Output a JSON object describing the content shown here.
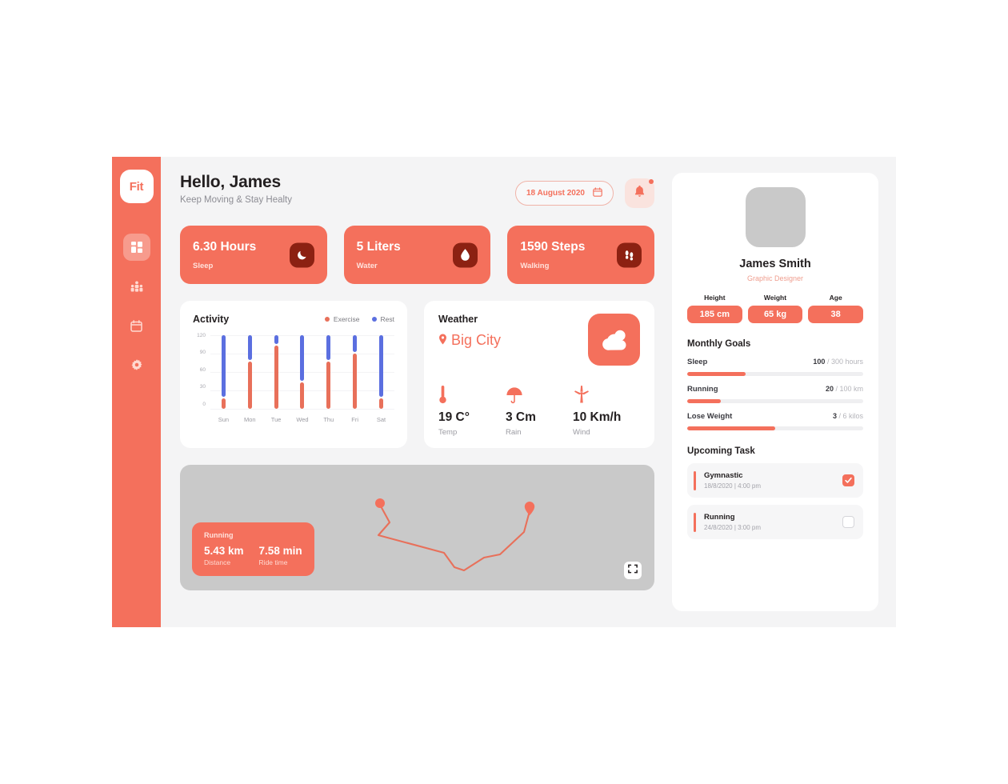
{
  "brand": {
    "logo_text": "Fit",
    "accent": "#F4705C",
    "accent_dark": "#8C2112",
    "rest_color": "#5B6FE0",
    "exercise_color": "#E8705A"
  },
  "sidebar": {
    "items": [
      {
        "name": "dashboard",
        "icon": "grid-icon",
        "active": true
      },
      {
        "name": "community",
        "icon": "people-icon",
        "active": false
      },
      {
        "name": "calendar",
        "icon": "calendar-icon",
        "active": false
      },
      {
        "name": "settings",
        "icon": "gear-icon",
        "active": false
      }
    ]
  },
  "header": {
    "title": "Hello, James",
    "subtitle": "Keep Moving & Stay Healty",
    "date_value": "18 August 2020",
    "date_icon": "calendar-icon",
    "bell_icon": "bell-icon"
  },
  "stats": [
    {
      "value": "6.30 Hours",
      "label": "Sleep",
      "icon": "moon-icon"
    },
    {
      "value": "5 Liters",
      "label": "Water",
      "icon": "water-drop-icon"
    },
    {
      "value": "1590 Steps",
      "label": "Walking",
      "icon": "footsteps-icon"
    }
  ],
  "chart_data": {
    "type": "bar",
    "title": "Activity",
    "stacked": true,
    "categories": [
      "Sun",
      "Mon",
      "Tue",
      "Wed",
      "Thu",
      "Fri",
      "Sat"
    ],
    "series": [
      {
        "name": "Exercise",
        "color": "#E8705A",
        "values": [
          17,
          77,
          103,
          43,
          77,
          90,
          17
        ]
      },
      {
        "name": "Rest",
        "color": "#5B6FE0",
        "values": [
          103,
          43,
          17,
          77,
          43,
          30,
          103
        ]
      }
    ],
    "ylim": [
      0,
      120
    ],
    "yticks": [
      120,
      90,
      60,
      30,
      0
    ],
    "xlabel": "",
    "ylabel": "",
    "grid": true,
    "legend_position": "top-right"
  },
  "weather": {
    "title": "Weather",
    "city": "Big City",
    "location_icon": "map-pin-icon",
    "condition_icon": "cloud-sun-icon",
    "metrics": [
      {
        "icon": "thermometer-icon",
        "value": "19 C°",
        "label": "Temp"
      },
      {
        "icon": "umbrella-icon",
        "value": "3 Cm",
        "label": "Rain"
      },
      {
        "icon": "windmill-icon",
        "value": "10 Km/h",
        "label": "Wind"
      }
    ]
  },
  "map": {
    "activity_title": "Running",
    "distance_value": "5.43 km",
    "distance_label": "Distance",
    "time_value": "7.58 min",
    "time_label": "Ride time",
    "fullscreen_icon": "expand-icon",
    "start_marker": "route-start-dot",
    "end_marker": "route-end-pin"
  },
  "profile": {
    "avatar": "user-avatar",
    "name": "James Smith",
    "role": "Graphic Designer",
    "vitals": [
      {
        "label": "Height",
        "value": "185 cm"
      },
      {
        "label": "Weight",
        "value": "65 kg"
      },
      {
        "label": "Age",
        "value": "38"
      }
    ]
  },
  "monthly_goals": {
    "title": "Monthly Goals",
    "items": [
      {
        "name": "Sleep",
        "current": "100",
        "target": "/ 300 hours",
        "percent": 33
      },
      {
        "name": "Running",
        "current": "20",
        "target": "/ 100 km",
        "percent": 19
      },
      {
        "name": "Lose Weight",
        "current": "3",
        "target": "/ 6 kilos",
        "percent": 50
      }
    ]
  },
  "upcoming_task": {
    "title": "Upcoming Task",
    "items": [
      {
        "name": "Gymnastic",
        "time": "18/8/2020 | 4:00 pm",
        "checked": true
      },
      {
        "name": "Running",
        "time": "24/8/2020 | 3:00 pm",
        "checked": false
      }
    ]
  }
}
